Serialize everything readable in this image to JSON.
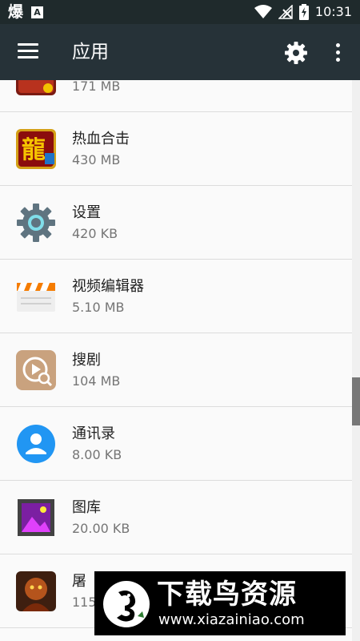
{
  "status_bar": {
    "left_glyph": "爆",
    "left_badge": "A",
    "time": "10:31"
  },
  "toolbar": {
    "title": "应用",
    "menu_icon": "hamburger-menu-icon",
    "settings_icon": "gear-icon",
    "overflow_icon": "more-vert-icon"
  },
  "apps": [
    {
      "name": "",
      "size": "171 MB",
      "icon": "game-dragon-icon"
    },
    {
      "name": "热血合击",
      "size": "430 MB",
      "icon": "rexue-heji-icon"
    },
    {
      "name": "设置",
      "size": "420 KB",
      "icon": "settings-gear-icon"
    },
    {
      "name": "视频编辑器",
      "size": "5.10 MB",
      "icon": "clapperboard-icon"
    },
    {
      "name": "搜剧",
      "size": "104 MB",
      "icon": "play-search-icon"
    },
    {
      "name": "通讯录",
      "size": "8.00 KB",
      "icon": "contacts-icon"
    },
    {
      "name": "图库",
      "size": "20.00 KB",
      "icon": "gallery-icon"
    },
    {
      "name": "屠",
      "size": "115",
      "icon": "warrior-game-icon"
    }
  ],
  "scrollbar": {
    "position": 0.58
  },
  "watermark": {
    "title": "下载鸟资源",
    "url": "www.xiazainiao.com"
  },
  "colors": {
    "toolbar": "#263238",
    "status_bar": "#1f2a2c",
    "background": "#fafafa",
    "divider": "#dcdcdc"
  }
}
